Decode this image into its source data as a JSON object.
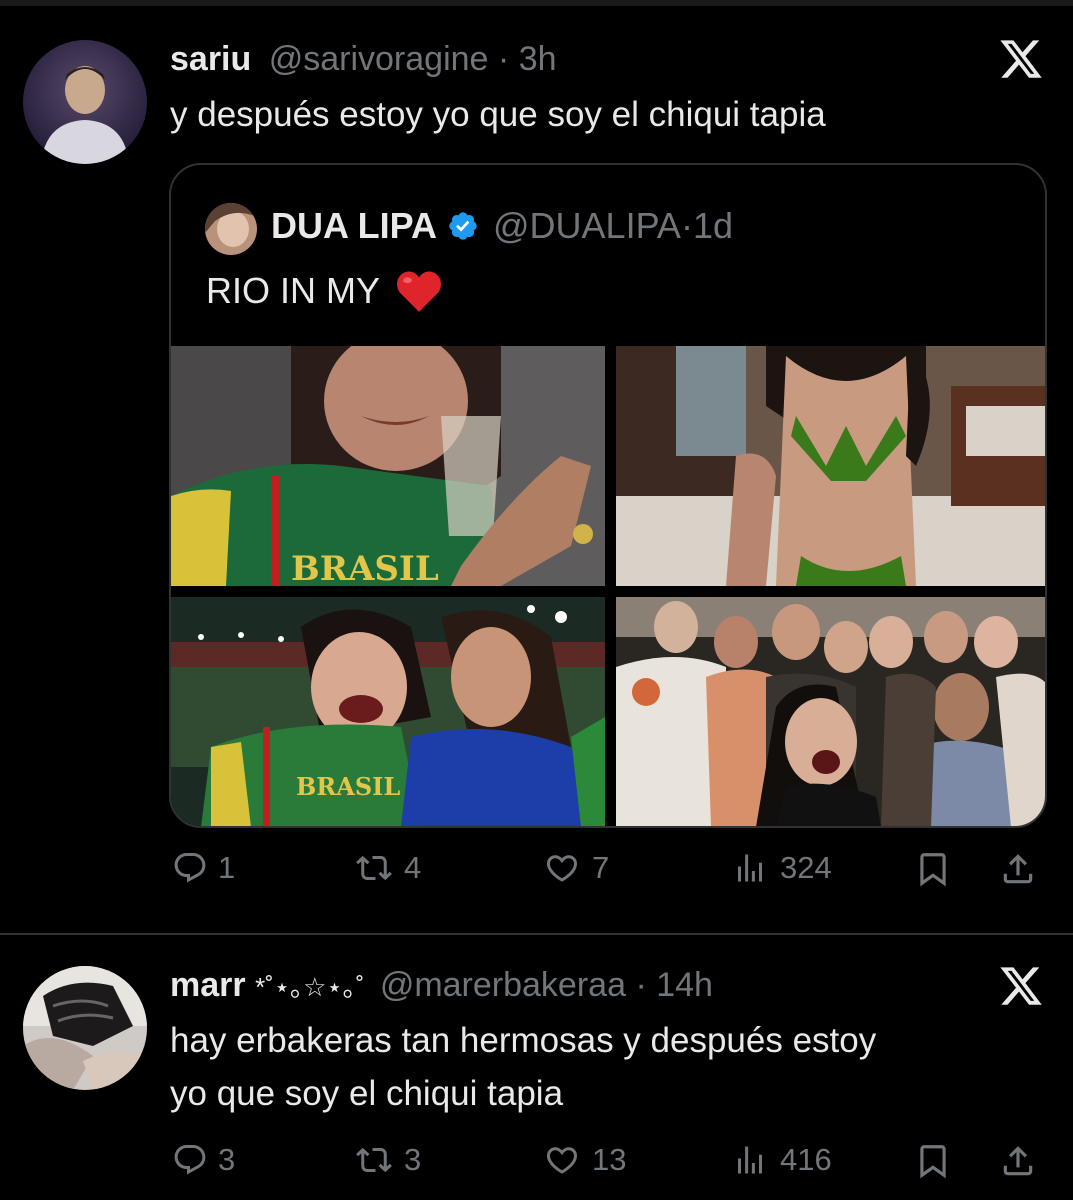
{
  "tweet1": {
    "name": "sariu",
    "handle": "@sarivoragine",
    "time": "3h",
    "text": "y después estoy yo que soy el chiqui tapia",
    "quoted": {
      "name": "DUA LIPA",
      "handle": "@DUALIPA",
      "time": "1d",
      "text": "RIO IN MY",
      "emoji_icon": "red-heart-icon",
      "photo_text_1": "BRASIL",
      "photo_text_3": "BRASIL"
    },
    "replies": "1",
    "retweets": "4",
    "likes": "7",
    "views": "324"
  },
  "tweet2": {
    "name": "marr",
    "name_symbols": "*˚⋆｡☆⋆｡˚",
    "handle": "@marerbakeraa",
    "time": "14h",
    "text_line1": "hay erbakeras tan hermosas y después estoy",
    "text_line2": "yo que soy el chiqui tapia",
    "replies": "3",
    "retweets": "3",
    "likes": "13",
    "views": "416"
  },
  "separator": "·",
  "colors": {
    "background": "#000000",
    "text": "#e7e9ea",
    "muted": "#71767b",
    "verified": "#1d9bf0",
    "heart": "#e0242b"
  }
}
